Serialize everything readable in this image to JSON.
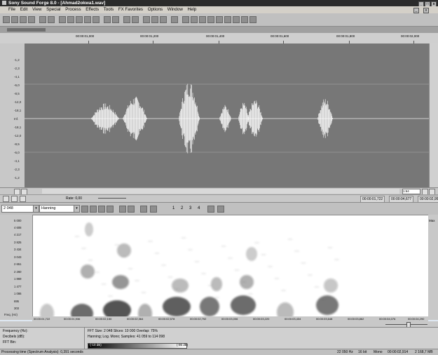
{
  "window": {
    "title": "Sony Sound Forge 8.0 - [Ahmad2okwa1.wav]"
  },
  "menu": [
    "File",
    "Edit",
    "View",
    "Special",
    "Process",
    "Effects",
    "Tools",
    "FX Favorites",
    "Options",
    "Window",
    "Help"
  ],
  "ruler": {
    "labels": [
      "00:00:01,000",
      "00:00:01,200",
      "00:00:01,400",
      "00:00:01,600",
      "00:00:01,800",
      "00:00:02,000"
    ]
  },
  "amplitude_labels": [
    "-1,2",
    "-2,3",
    "-4,1",
    "-6,0",
    "-8,5",
    "-12,0",
    "-18,1",
    "Inf.",
    "-18,1",
    "-12,0",
    "-8,5",
    "-6,0",
    "-4,1",
    "-2,3",
    "-1,2"
  ],
  "scroll": {
    "zoom": "1:64"
  },
  "status": {
    "rate_label": "Rate: 0,00",
    "sel1": "00:00:01,722",
    "sel2": "00:00:04,677",
    "sel3": "00:00:02,955"
  },
  "spectrum": {
    "fft_size": "2 048",
    "window": "Hanning",
    "toolbar_numbers": [
      "1",
      "2",
      "3",
      "4"
    ],
    "freq_labels": [
      "5 000",
      "4 608",
      "4 217",
      "3 825",
      "3 434",
      "3 043",
      "2 651",
      "2 260",
      "1 869",
      "1 477",
      "1 086",
      "695",
      "303"
    ],
    "freq_axis_title": "Freq. (Hz)",
    "right_label": "Max",
    "time_labels": [
      "00:00:01,722",
      "00:00:01,936",
      "00:00:02,150",
      "00:00:02,364",
      "00:00:02,578",
      "00:00:02,792",
      "00:00:03,006",
      "00:00:03,220",
      "00:00:03,434",
      "00:00:03,648",
      "00:00:03,862",
      "00:00:04,076",
      "00:00:04,290"
    ]
  },
  "info": {
    "frequency": "Frequency (Hz):",
    "decibels": "Decibels (dB):",
    "fft_bin": "FFT Bin:",
    "fft_line1": "FFT Size: 2 048  Slices: 10 000  Overlap: 75%",
    "fft_line2": "Hanning; Log. Mono; Samples: 41 059 to 114 098",
    "colorbar_left": "-(-10 dB)",
    "colorbar_right": "(-96 dB)"
  },
  "bottom": {
    "left": "Processing time (Spectrum Analysis): 0,391 seconds",
    "rate": "22 050 Hz",
    "bits": "16 bit",
    "channels": "Mono",
    "length": "00:00:02,914",
    "size": "2 168,7 MB"
  }
}
